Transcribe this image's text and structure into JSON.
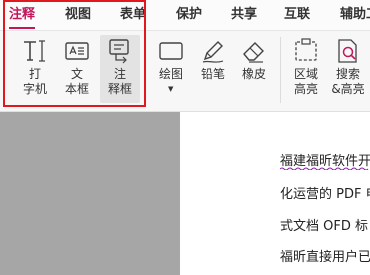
{
  "menu": {
    "tabs": [
      {
        "label": "注释",
        "active": true
      },
      {
        "label": "视图"
      },
      {
        "label": "表单"
      },
      {
        "label": "保护"
      },
      {
        "label": "共享"
      },
      {
        "label": "互联"
      },
      {
        "label": "辅助工"
      }
    ]
  },
  "ribbon": {
    "tools": [
      {
        "label": "打\n字机",
        "icon": "typewriter-icon"
      },
      {
        "label": "文\n本框",
        "icon": "textbox-icon"
      },
      {
        "label": "注\n释框",
        "icon": "callout-icon",
        "selected": true
      },
      {
        "label": "绘图",
        "icon": "rectangle-icon",
        "has_dropdown": true
      },
      {
        "label": "铅笔",
        "icon": "pencil-icon"
      },
      {
        "label": "橡皮",
        "icon": "eraser-icon"
      },
      {
        "label": "区域\n高亮",
        "icon": "area-highlight-icon"
      },
      {
        "label": "搜索\n&高亮",
        "icon": "search-highlight-icon"
      }
    ]
  },
  "document": {
    "lines": [
      "福建福昕软件开",
      "化运营的 PDF 电",
      "式文档 OFD 标",
      "福昕直接用户已"
    ]
  },
  "colors": {
    "accent": "#c2185b",
    "highlight_box": "#e0191e",
    "gray_background": "#a6a6a6"
  }
}
